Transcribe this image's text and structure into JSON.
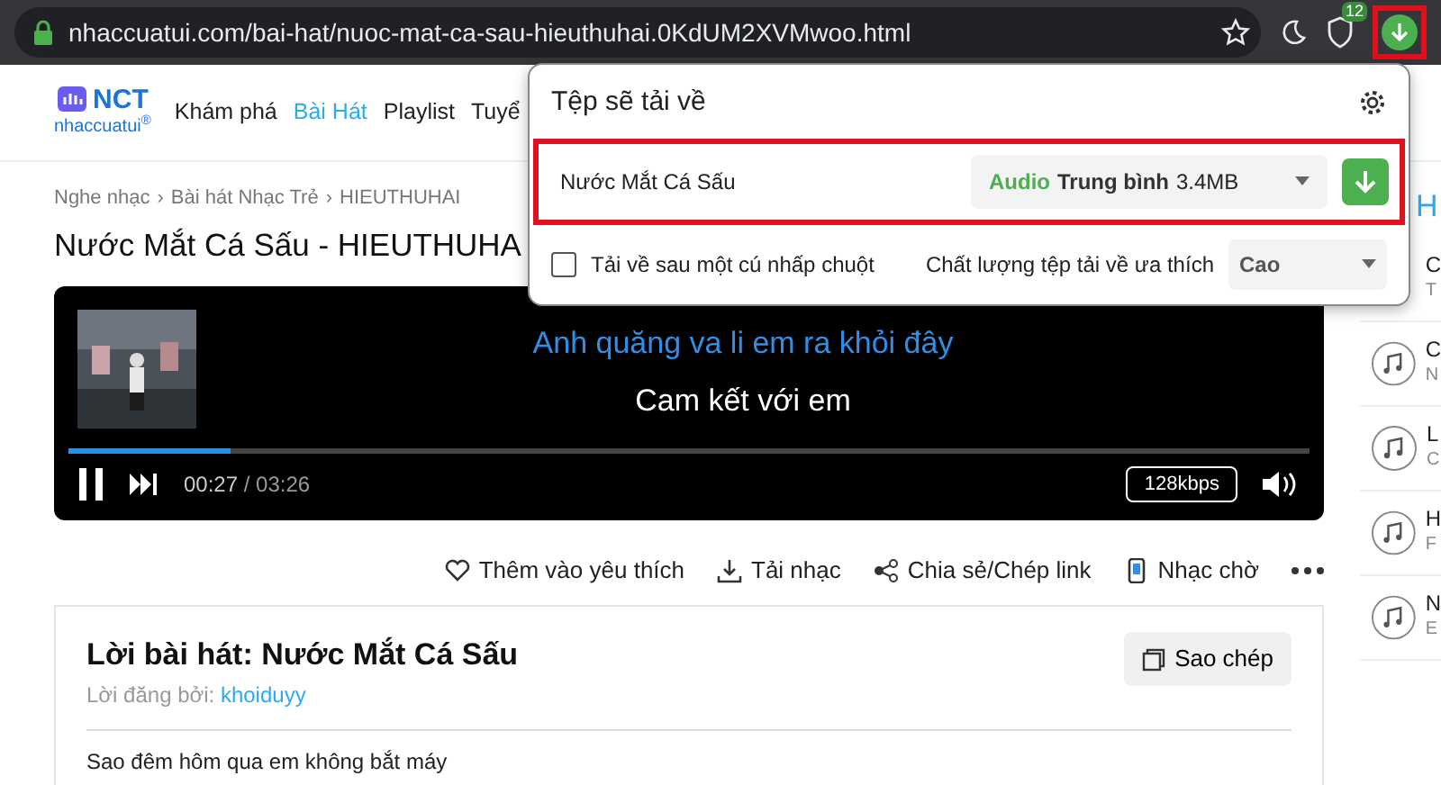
{
  "browser": {
    "url": "nhaccuatui.com/bai-hat/nuoc-mat-ca-sau-hieuthuhai.0KdUM2XVMwoo.html",
    "extension_badge": "12",
    "download_button": {
      "highlighted": true
    }
  },
  "site_nav": {
    "logo": "NCT",
    "logo_sub": "nhaccuatui$^{®}$",
    "items": [
      {
        "label": "Khám phá",
        "selected": false
      },
      {
        "label": "Bài Hát",
        "selected": true
      },
      {
        "label": "Playlist",
        "selected": false
      },
      {
        "label": "Tuyể",
        "selected": false
      }
    ]
  },
  "breadcrumb": {
    "separator": "›",
    "items": [
      "Nghe nhạc",
      "Bài hát Nhạc Trẻ",
      "HIEUTHUHAI"
    ]
  },
  "title": "Nước Mắt Cá Sấu - HIEUTHUHA",
  "player": {
    "lyric_current": "Anh quăng va li em ra khỏi đây",
    "lyric_next": "Cam kết với em",
    "level": 0.13,
    "playing": true,
    "elapsed": "00:27",
    "total": "/ 03:26",
    "bitrate": "128kbps"
  },
  "actions": [
    {
      "kind": "heart",
      "label": "Thêm vào yêu thích"
    },
    {
      "kind": "download",
      "label": "Tải nhạc"
    },
    {
      "kind": "share",
      "label": "Chia sẻ/Chép link"
    },
    {
      "kind": "phone",
      "label": "Nhạc chờ"
    }
  ],
  "lyrics": {
    "title": "Lời bài hát: Nước Mắt Cá Sấu",
    "posted_by": "Lời đăng bởi:",
    "author": "khoiduyy",
    "copy_button": "Sao chép",
    "lines": [
      "Sao đêm hôm qua em không bắt máy"
    ]
  },
  "sidebar": {
    "heading": "H",
    "items": [
      {
        "title": "C",
        "subtitle": "T",
        "icon": false
      },
      {
        "title": "C",
        "subtitle": "N",
        "icon": true
      },
      {
        "title": "L",
        "subtitle": "C",
        "icon": true
      },
      {
        "title": "H",
        "subtitle": "F",
        "icon": true
      },
      {
        "title": "N",
        "subtitle": "E",
        "icon": true
      }
    ]
  },
  "popup": {
    "title": "Tệp sẽ tải về",
    "file": {
      "name": "Nước Mắt Cá Sấu",
      "type": "Audio",
      "quality": "Trung bình",
      "size": "3.4MB",
      "highlighted": true
    },
    "one_click": {
      "label": "Tải về sau một cú nhấp chuột",
      "checked": false
    },
    "preference_label": "Chất lượng tệp tải về ưa thích",
    "preference_value": "Cao"
  }
}
